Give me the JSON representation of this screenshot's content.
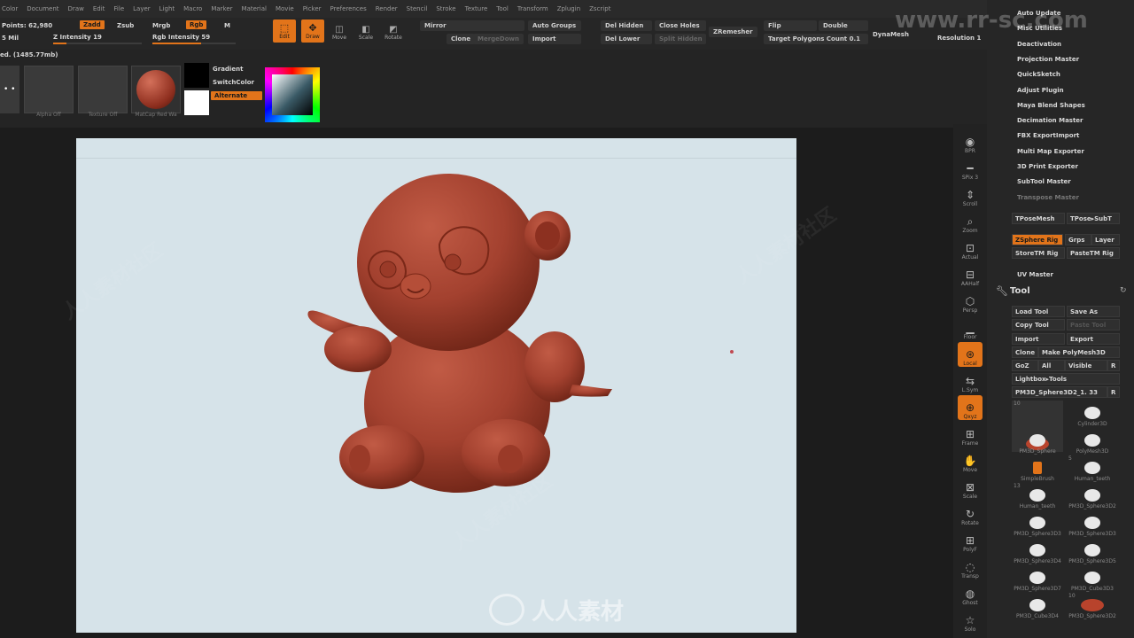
{
  "menu": [
    "Color",
    "Document",
    "Draw",
    "Edit",
    "File",
    "Layer",
    "Light",
    "Macro",
    "Marker",
    "Material",
    "Movie",
    "Picker",
    "Preferences",
    "Render",
    "Stencil",
    "Stroke",
    "Texture",
    "Tool",
    "Transform",
    "Zplugin",
    "Zscript"
  ],
  "stats": {
    "points": "Points: 62,980",
    "mil": "5 Mil",
    "size": "ed. (1485.77mb)"
  },
  "top": {
    "zadd": "Zadd",
    "zsub": "Zsub",
    "z_intensity": "Z Intensity 19",
    "mrgb": "Mrgb",
    "rgb": "Rgb",
    "m": "M",
    "rgb_intensity": "Rgb Intensity 59",
    "edit": "Edit",
    "draw": "Draw",
    "move": "Move",
    "scale": "Scale",
    "rotate": "Rotate",
    "mirror": "Mirror",
    "auto_groups": "Auto Groups",
    "clone": "Clone",
    "merge_down": "MergeDown",
    "import": "Import",
    "del_hidden": "Del Hidden",
    "close_holes": "Close Holes",
    "del_lower": "Del Lower",
    "split_hidden": "Split Hidden",
    "zremesher": "ZRemesher",
    "flip": "Flip",
    "double": "Double",
    "target_polygons": "Target Polygons Count 0.1",
    "dynamesh": "DynaMesh",
    "resolution": "Resolution 1",
    "z_intensity_pct": 0.15,
    "rgb_intensity_pct": 0.59
  },
  "shelf": {
    "alpha_off": "Alpha Off",
    "texture_off": "Texture Off",
    "matcap": "MatCap Red Wa",
    "gradient": "Gradient",
    "switch_color": "SwitchColor",
    "alternate": "Alternate"
  },
  "right_icons": [
    "BPR",
    "SPix 3",
    "Scroll",
    "Zoom",
    "Actual",
    "AAHalf",
    "Persp",
    "Floor",
    "Local",
    "L.Sym",
    "Qxyz",
    "Frame",
    "Move",
    "Scale",
    "Rotate",
    "PolyF",
    "Transp",
    "Ghost",
    "Solo"
  ],
  "plugins": [
    "Auto Update",
    "Misc Utilities",
    "Deactivation",
    "Projection Master",
    "QuickSketch",
    "Adjust Plugin",
    "Maya Blend Shapes",
    "Decimation Master",
    "FBX ExportImport",
    "Multi Map Exporter",
    "3D Print Exporter",
    "SubTool Master",
    "Transpose Master"
  ],
  "transpose": {
    "tposemesh": "TPoseMesh",
    "tpose_subt": "TPose▸SubT",
    "zsphere_rig": "ZSphere Rig",
    "grps": "Grps",
    "layer": "Layer",
    "storetm_rig": "StoreTM Rig",
    "pastetm_rig": "PasteTM Rig"
  },
  "uv_master": "UV Master",
  "tool": {
    "title": "Tool",
    "load_tool": "Load Tool",
    "save_as": "Save As",
    "copy_tool": "Copy Tool",
    "paste_tool": "Paste Tool",
    "import": "Import",
    "export": "Export",
    "clone": "Clone",
    "make_polymesh": "Make PolyMesh3D",
    "goz": "GoZ",
    "all": "All",
    "visible": "Visible",
    "r": "R",
    "lightbox_tools": "Lightbox▸Tools",
    "current": "PM3D_Sphere3D2_1. 33",
    "r2": "R",
    "items": [
      {
        "n": "",
        "count": "10"
      },
      {
        "n": "Cylinder3D",
        "count": ""
      },
      {
        "n": "PM3D_Sphere",
        "count": ""
      },
      {
        "n": "PolyMesh3D",
        "count": ""
      },
      {
        "n": "SimpleBrush",
        "count": ""
      },
      {
        "n": "Human_teeth",
        "count": "5"
      },
      {
        "n": "Human_teeth",
        "count": "13"
      },
      {
        "n": "PM3D_Sphere3D2",
        "count": ""
      },
      {
        "n": "PM3D_Sphere3D3",
        "count": ""
      },
      {
        "n": "PM3D_Sphere3D3",
        "count": ""
      },
      {
        "n": "PM3D_Sphere3D4",
        "count": ""
      },
      {
        "n": "PM3D_Sphere3D5",
        "count": ""
      },
      {
        "n": "PM3D_Sphere3D7",
        "count": ""
      },
      {
        "n": "PM3D_Cube3D3",
        "count": ""
      },
      {
        "n": "PM3D_Cube3D4",
        "count": ""
      },
      {
        "n": "PM3D_Sphere3D2",
        "count": "10"
      }
    ]
  },
  "watermark": {
    "site": "www.rr-sc.com",
    "brand": "人人素材",
    "wm": "人人素材社区"
  },
  "colors": {
    "accent": "#e2741a",
    "canvas": "#d6e3e9",
    "model": "#a8412f"
  }
}
